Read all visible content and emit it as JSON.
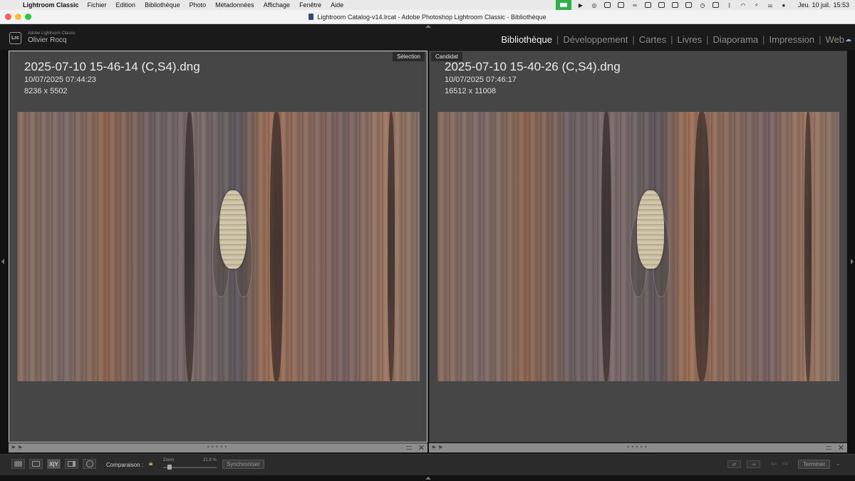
{
  "menubar": {
    "app_name": "Lightroom Classic",
    "menus": [
      "Fichier",
      "Edition",
      "Bibliothèque",
      "Photo",
      "Métadonnées",
      "Affichage",
      "Fenêtre",
      "Aide"
    ],
    "date": "Jeu. 10 juil.",
    "time": "15:53"
  },
  "window": {
    "title": "Lightroom Catalog-v14.lrcat - Adobe Photoshop Lightroom Classic - Bibliothèque"
  },
  "identity": {
    "logo_text": "Lrc",
    "brand": "Adobe Lightroom Classic",
    "user": "Olivier Rocq"
  },
  "modules": [
    {
      "label": "Bibliothèque",
      "active": true
    },
    {
      "label": "Développement",
      "active": false
    },
    {
      "label": "Cartes",
      "active": false
    },
    {
      "label": "Livres",
      "active": false
    },
    {
      "label": "Diaporama",
      "active": false
    },
    {
      "label": "Impression",
      "active": false
    },
    {
      "label": "Web",
      "active": false
    }
  ],
  "compare": {
    "select": {
      "badge": "Sélection",
      "filename": "2025-07-10 15-46-14 (C,S4).dng",
      "datetime": "10/07/2025 07:44:23",
      "dimensions": "8236 x 5502"
    },
    "candidate": {
      "badge": "Candidat",
      "filename": "2025-07-10 15-40-26 (C,S4).dng",
      "datetime": "10/07/2025 07:46:17",
      "dimensions": "16512 x 11008"
    }
  },
  "toolbar": {
    "compare_label": "Comparaison :",
    "compare_icon_text": "X|Y",
    "zoom_label": "Zoom",
    "zoom_value": "21.9 %",
    "zoom_fraction": 0.12,
    "sync_label": "Synchroniser",
    "done_label": "Terminer"
  },
  "colors": {
    "accent_active": "#f2f2f2",
    "facetime": "#2bb34a",
    "lock": "#c9a83a"
  }
}
